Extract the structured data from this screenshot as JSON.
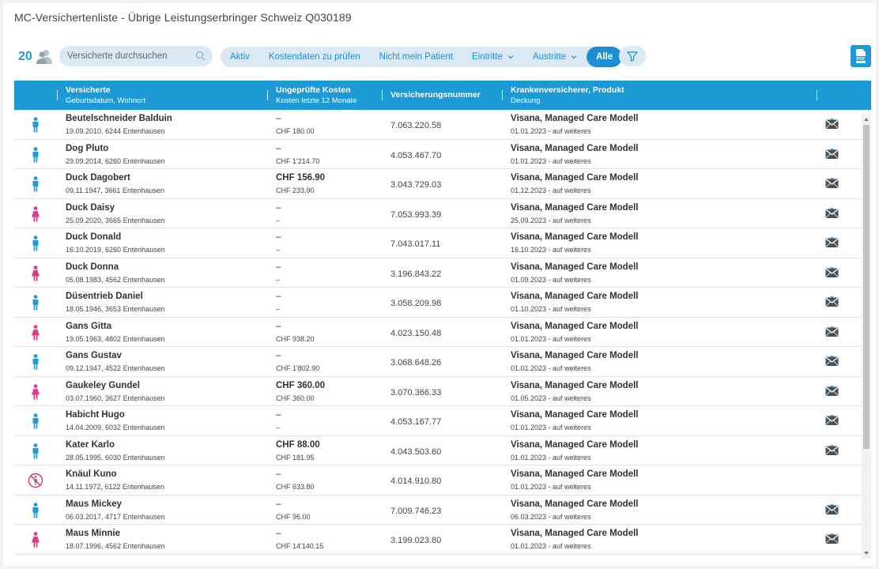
{
  "header": {
    "title": "MC-Versichertenliste - Übrige Leistungserbringer Schweiz Q030189"
  },
  "toolbar": {
    "count": "20",
    "search_placeholder": "Versicherte durchsuchen",
    "filters": [
      {
        "label": "Aktiv",
        "active": false,
        "dropdown": false
      },
      {
        "label": "Kostendaten zu prüfen",
        "active": false,
        "dropdown": false
      },
      {
        "label": "Nicht mein Patient",
        "active": false,
        "dropdown": false
      },
      {
        "label": "Eintritte",
        "active": false,
        "dropdown": true
      },
      {
        "label": "Austritte",
        "active": false,
        "dropdown": true
      },
      {
        "label": "Alle",
        "active": true,
        "dropdown": false
      }
    ],
    "pdf_label": "PDF"
  },
  "colors": {
    "accent": "#1c9ad6",
    "male": "#1d9bd7",
    "female": "#e5388c",
    "pill": "#dbe9f5"
  },
  "table": {
    "headers": {
      "col1_title": "Versicherte",
      "col1_sub": "Geburtsdatum, Wohnort",
      "col2_title": "Ungeprüfte Kosten",
      "col2_sub": "Kosten letzte 12 Monate",
      "col3_title": "Versicherungsnummer",
      "col4_title": "Krankenversicherer, Produkt",
      "col4_sub": "Deckung"
    },
    "rows": [
      {
        "gender": "male",
        "name": "Beutelschneider Balduin",
        "details": "19.09.2010, 6244 Entenhausen",
        "unchecked": "–",
        "unchecked_bold": false,
        "costs12": "CHF 180.00",
        "number": "7.063.220.58",
        "insurer": "Visana, Managed Care Modell",
        "coverage": "01.01.2023 - auf weiteres",
        "mail": true
      },
      {
        "gender": "male",
        "name": "Dog Pluto",
        "details": "29.09.2014, 6260 Entenhausen",
        "unchecked": "–",
        "unchecked_bold": false,
        "costs12": "CHF 1'214.70",
        "number": "4.053.467.70",
        "insurer": "Visana, Managed Care Modell",
        "coverage": "01.01.2023 - auf weiteres",
        "mail": true
      },
      {
        "gender": "male",
        "name": "Duck Dagobert",
        "details": "09.11.1947, 3661 Entenhausen",
        "unchecked": "CHF 156.90",
        "unchecked_bold": true,
        "costs12": "CHF 233.90",
        "number": "3.043.729.03",
        "insurer": "Visana, Managed Care Modell",
        "coverage": "01.12.2023 - auf weiteres",
        "mail": true
      },
      {
        "gender": "female",
        "name": "Duck Daisy",
        "details": "25.09.2020, 3665 Entenhausen",
        "unchecked": "–",
        "unchecked_bold": false,
        "costs12": "–",
        "number": "7.053.993.39",
        "insurer": "Visana, Managed Care Modell",
        "coverage": "25.09.2023 - auf weiteres",
        "mail": true
      },
      {
        "gender": "male",
        "name": "Duck Donald",
        "details": "16.10.2019, 6260 Entenhausen",
        "unchecked": "–",
        "unchecked_bold": false,
        "costs12": "–",
        "number": "7.043.017.11",
        "insurer": "Visana, Managed Care Modell",
        "coverage": "16.10.2023 - auf weiteres",
        "mail": true
      },
      {
        "gender": "female",
        "name": "Duck Donna",
        "details": "05.08.1983, 4562 Entenhausen",
        "unchecked": "–",
        "unchecked_bold": false,
        "costs12": "–",
        "number": "3.196.843.22",
        "insurer": "Visana, Managed Care Modell",
        "coverage": "01.09.2023 - auf weiteres",
        "mail": true
      },
      {
        "gender": "male",
        "name": "Düsentrieb Daniel",
        "details": "18.05.1946, 3653 Entenhausen",
        "unchecked": "–",
        "unchecked_bold": false,
        "costs12": "–",
        "number": "3.058.209.98",
        "insurer": "Visana, Managed Care Modell",
        "coverage": "01.10.2023 - auf weiteres",
        "mail": true
      },
      {
        "gender": "female",
        "name": "Gans Gitta",
        "details": "19.05.1963, 4802 Entenhausen",
        "unchecked": "–",
        "unchecked_bold": false,
        "costs12": "CHF 938.20",
        "number": "4.023.150.48",
        "insurer": "Visana, Managed Care Modell",
        "coverage": "01.01.2023 - auf weiteres",
        "mail": true
      },
      {
        "gender": "male",
        "name": "Gans Gustav",
        "details": "09.12.1947, 4522 Entenhausen",
        "unchecked": "–",
        "unchecked_bold": false,
        "costs12": "CHF 1'802.90",
        "number": "3.068.648.26",
        "insurer": "Visana, Managed Care Modell",
        "coverage": "01.01.2023 - auf weiteres",
        "mail": true
      },
      {
        "gender": "female",
        "name": "Gaukeley Gundel",
        "details": "03.07.1960, 3627 Entenhausen",
        "unchecked": "CHF 360.00",
        "unchecked_bold": true,
        "costs12": "CHF 360.00",
        "number": "3.070.366.33",
        "insurer": "Visana, Managed Care Modell",
        "coverage": "01.05.2023 - auf weiteres",
        "mail": true
      },
      {
        "gender": "male",
        "name": "Habicht Hugo",
        "details": "14.04.2009, 6032 Entenhausen",
        "unchecked": "–",
        "unchecked_bold": false,
        "costs12": "–",
        "number": "4.053.167.77",
        "insurer": "Visana, Managed Care Modell",
        "coverage": "01.01.2023 - auf weiteres",
        "mail": true
      },
      {
        "gender": "male",
        "name": "Kater Karlo",
        "details": "28.05.1995, 6030 Entenhausen",
        "unchecked": "CHF 88.00",
        "unchecked_bold": true,
        "costs12": "CHF 181.95",
        "number": "4.043.503.60",
        "insurer": "Visana, Managed Care Modell",
        "coverage": "01.01.2023 - auf weiteres",
        "mail": true
      },
      {
        "gender": "blocked",
        "name": "Knäul Kuno",
        "details": "14.11.1972, 6122 Entenhausen",
        "unchecked": "–",
        "unchecked_bold": false,
        "costs12": "CHF 633.80",
        "number": "4.014.910.80",
        "insurer": "Visana, Managed Care Modell",
        "coverage": "01.01.2023 - auf weiteres",
        "mail": false
      },
      {
        "gender": "male",
        "name": "Maus Mickey",
        "details": "06.03.2017, 4717 Entenhausen",
        "unchecked": "–",
        "unchecked_bold": false,
        "costs12": "CHF 96.00",
        "number": "7.009.746.23",
        "insurer": "Visana, Managed Care Modell",
        "coverage": "06.03.2023 - auf weiteres",
        "mail": true
      },
      {
        "gender": "female",
        "name": "Maus Minnie",
        "details": "18.07.1996, 4562 Entenhausen",
        "unchecked": "–",
        "unchecked_bold": false,
        "costs12": "CHF 14'140.15",
        "number": "3.199.023.80",
        "insurer": "Visana, Managed Care Modell",
        "coverage": "01.01.2023 - auf weiteres",
        "mail": true
      }
    ]
  }
}
